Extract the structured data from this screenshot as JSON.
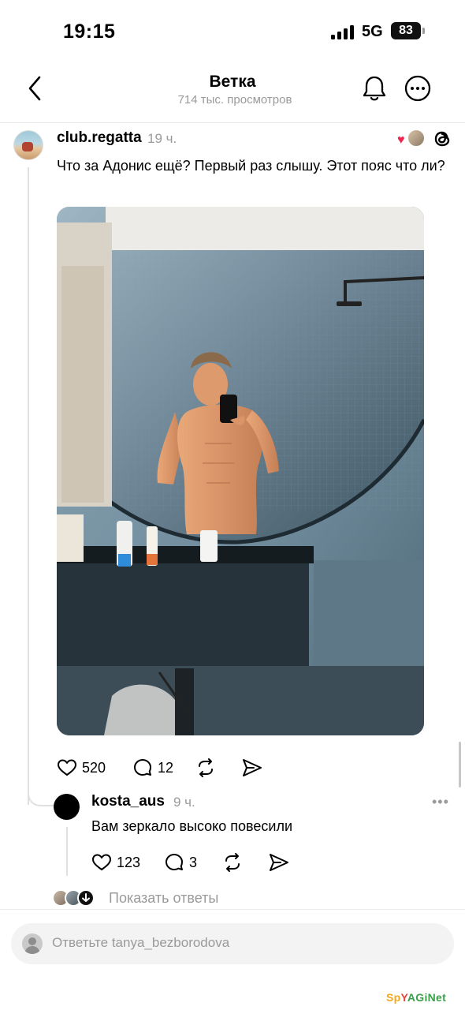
{
  "status_bar": {
    "time": "19:15",
    "network": "5G",
    "battery": "83"
  },
  "header": {
    "title": "Ветка",
    "subtitle": "714 тыс. просмотров"
  },
  "post": {
    "username": "club.regatta",
    "time": "19 ч.",
    "text": "Что за Адонис ещё? Первый раз слышу. Этот пояс что ли?",
    "likes": "520",
    "comments": "12"
  },
  "reply": {
    "username": "kosta_aus",
    "time": "9 ч.",
    "more": "•••",
    "text": "Вам зеркало высоко повесили",
    "likes": "123",
    "comments": "3"
  },
  "show_replies": {
    "label": "Показать ответы"
  },
  "composer": {
    "placeholder": "Ответьте tanya_bezborodova"
  },
  "watermark": {
    "parts": [
      "Sp",
      "Y",
      "AGiNet"
    ]
  },
  "colors": {
    "reaction_heart": "#f0244f",
    "muted_text": "#9a9a9a",
    "watermark": "#f3a81c"
  }
}
